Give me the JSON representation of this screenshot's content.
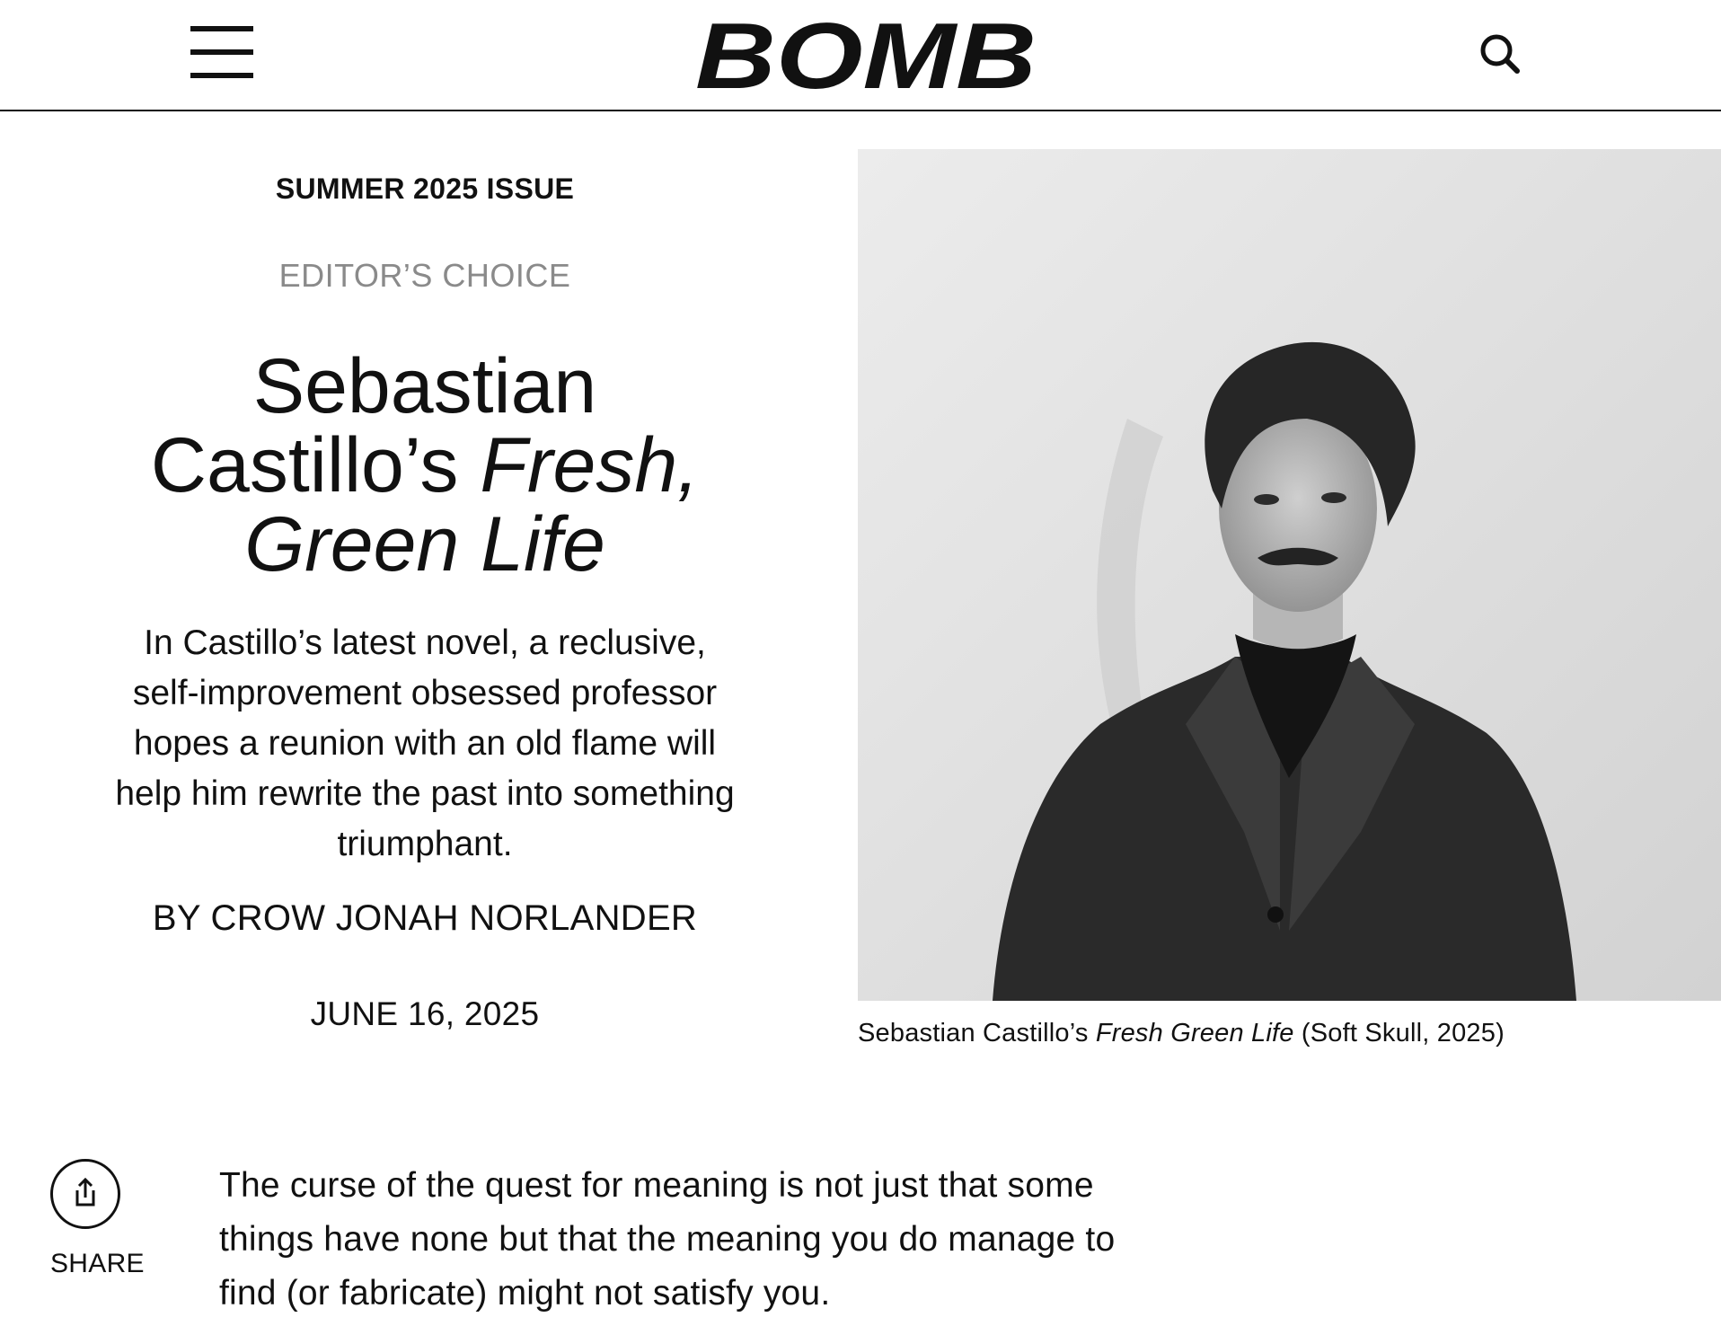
{
  "header": {
    "logo_text": "BOMB",
    "menu_icon": "hamburger-menu-icon",
    "search_icon": "search-icon"
  },
  "article": {
    "issue": "SUMMER 2025 ISSUE",
    "category": "EDITOR’S CHOICE",
    "title_part1": "Sebastian Castillo’s ",
    "title_italic": "Fresh, Green Life",
    "dek": "In Castillo’s latest novel, a reclusive, self-improvement obsessed professor hopes a reunion with an old flame will help him rewrite the past into something triumphant.",
    "byline": "BY CROW JONAH NORLANDER",
    "date": "JUNE 16, 2025"
  },
  "photo": {
    "caption_part1": "Sebastian Castillo’s ",
    "caption_italic": "Fresh Green Life",
    "caption_part2": " (Soft Skull, 2025)"
  },
  "share": {
    "label": "SHARE",
    "icon": "share-icon"
  },
  "body": {
    "first_paragraph": "The curse of the quest for meaning is not just that some things have none but that the meaning you do manage to find (or fabricate) might not satisfy you."
  }
}
